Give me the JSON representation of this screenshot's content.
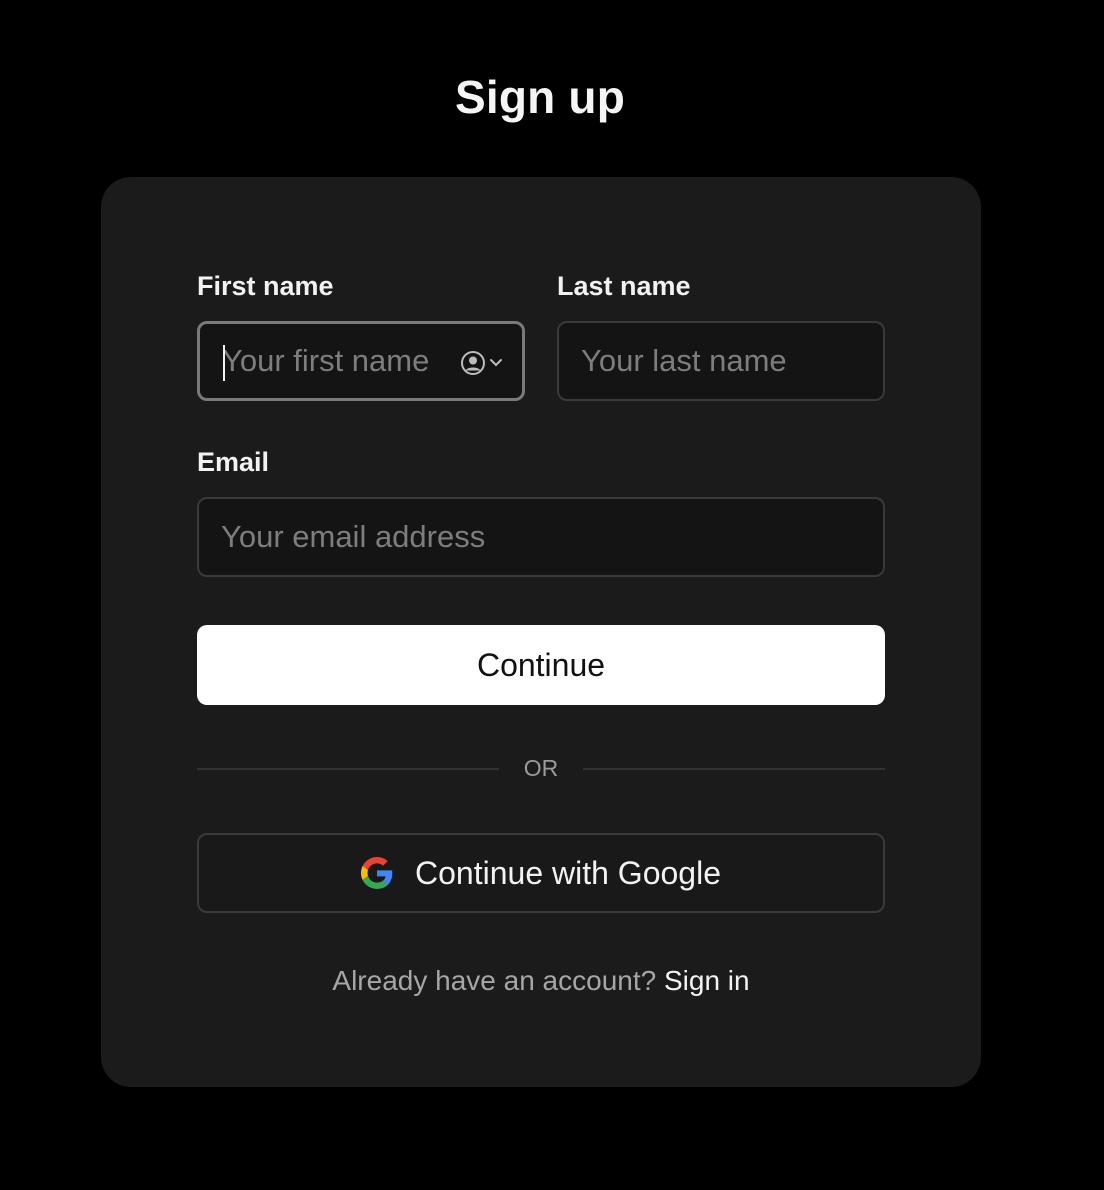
{
  "page": {
    "title": "Sign up"
  },
  "form": {
    "first_name": {
      "label": "First name",
      "placeholder": "Your first name",
      "value": ""
    },
    "last_name": {
      "label": "Last name",
      "placeholder": "Your last name",
      "value": ""
    },
    "email": {
      "label": "Email",
      "placeholder": "Your email address",
      "value": ""
    },
    "continue_label": "Continue",
    "divider_text": "OR",
    "google_label": "Continue with Google",
    "footer_prompt": "Already have an account?",
    "signin_label": "Sign in"
  },
  "icons": {
    "autofill": "contact-autofill-icon",
    "google": "google-icon"
  },
  "colors": {
    "background": "#000000",
    "card": "#1b1b1b",
    "input_bg": "#141414",
    "input_border": "#3a3a3a",
    "focus_border": "#7a7a7a",
    "primary_button": "#ffffff",
    "placeholder": "#7d7d7d",
    "google_blue": "#4285F4",
    "google_red": "#EA4335",
    "google_yellow": "#FBBC05",
    "google_green": "#34A853"
  }
}
